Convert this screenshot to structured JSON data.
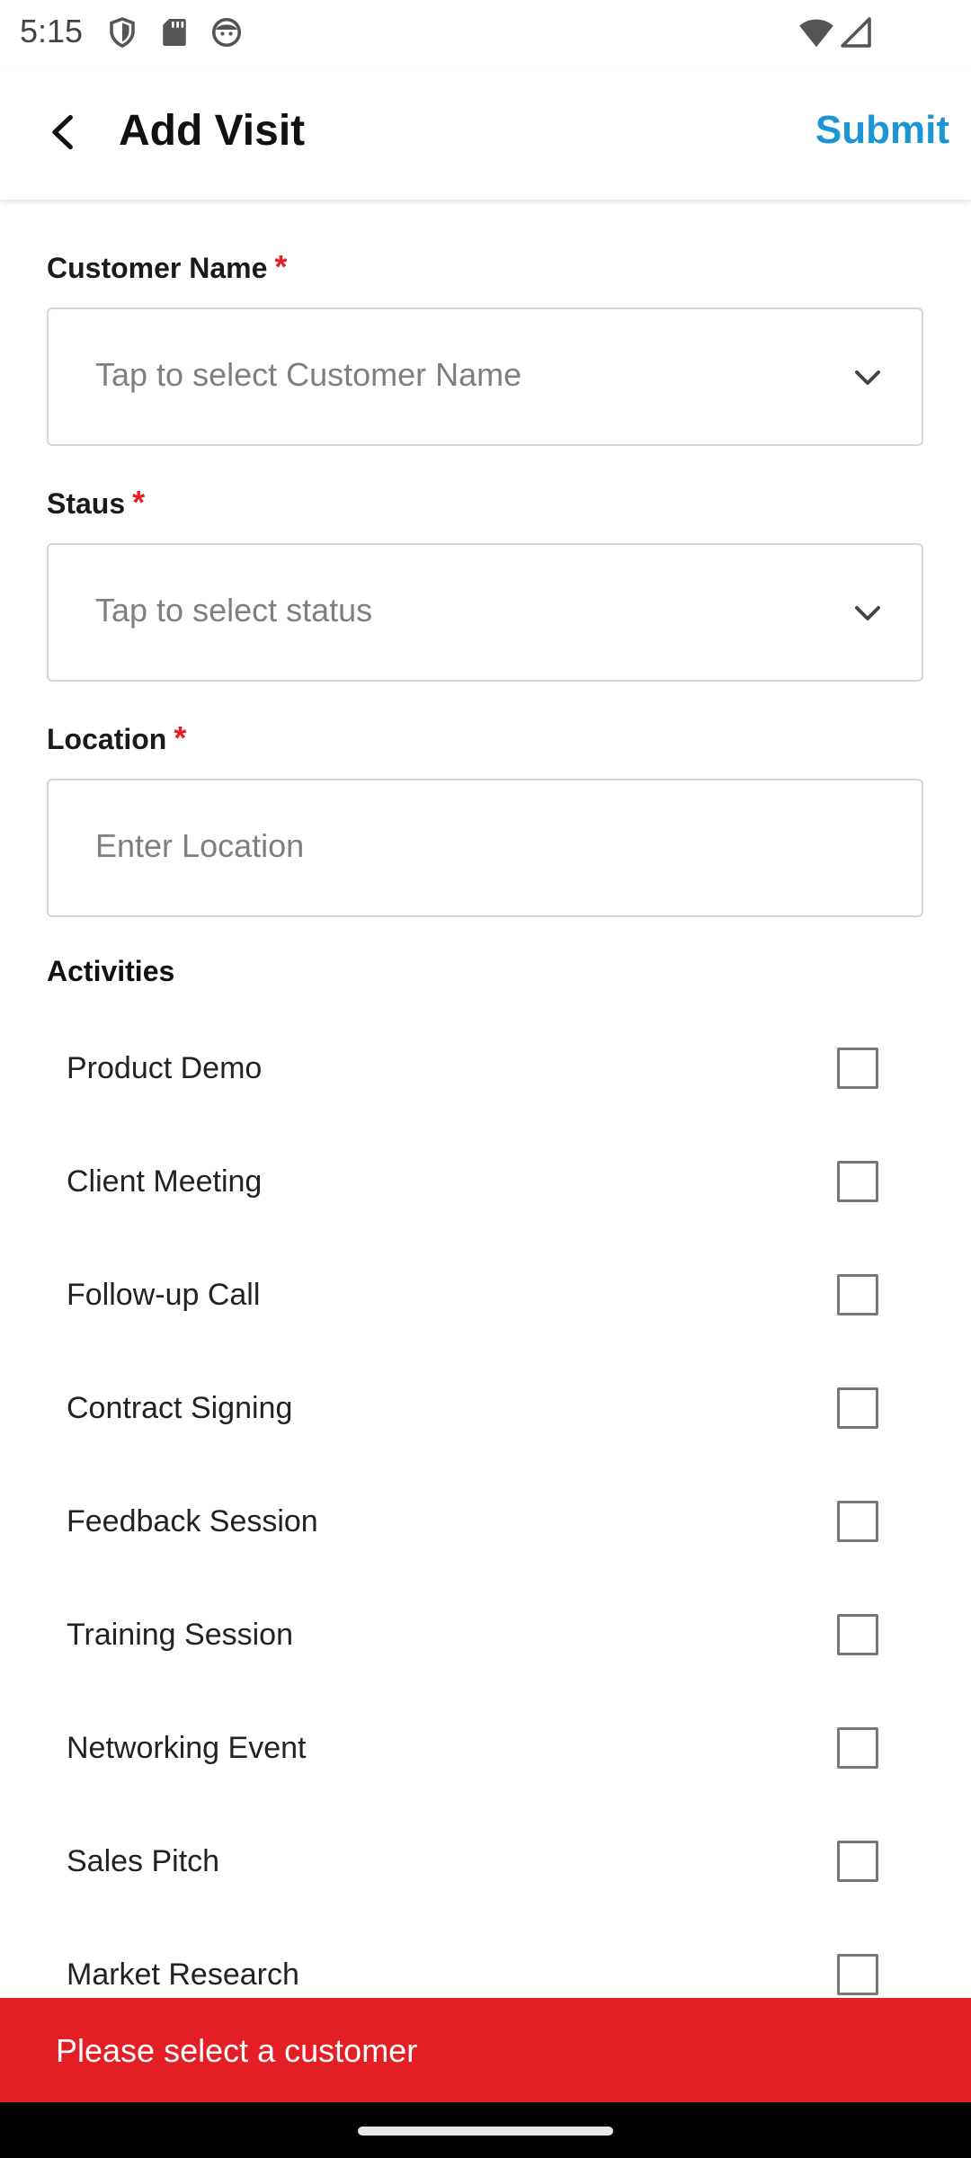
{
  "status_bar": {
    "time": "5:15",
    "left_icons": [
      "shield-icon",
      "sd-card-icon",
      "face-icon"
    ],
    "right_icons": [
      "wifi-icon",
      "signal-icon"
    ]
  },
  "app_bar": {
    "title": "Add Visit",
    "submit_label": "Submit",
    "back_icon": "back-arrow-icon",
    "accent_color": "#1a95d5"
  },
  "form": {
    "customer_name": {
      "label": "Customer Name",
      "required_mark": "*",
      "placeholder": "Tap to select Customer Name"
    },
    "status": {
      "label": "Staus",
      "required_mark": "*",
      "placeholder": "Tap to select status"
    },
    "location": {
      "label": "Location",
      "required_mark": "*",
      "placeholder": "Enter Location"
    },
    "activities": {
      "title": "Activities",
      "items": [
        {
          "label": "Product Demo",
          "checked": false
        },
        {
          "label": "Client Meeting",
          "checked": false
        },
        {
          "label": "Follow-up Call",
          "checked": false
        },
        {
          "label": "Contract Signing",
          "checked": false
        },
        {
          "label": "Feedback Session",
          "checked": false
        },
        {
          "label": "Training Session",
          "checked": false
        },
        {
          "label": "Networking Event",
          "checked": false
        },
        {
          "label": "Sales Pitch",
          "checked": false
        },
        {
          "label": "Market Research",
          "checked": false
        }
      ]
    }
  },
  "snackbar": {
    "message": "Please select a customer",
    "color": "#e31e24"
  }
}
